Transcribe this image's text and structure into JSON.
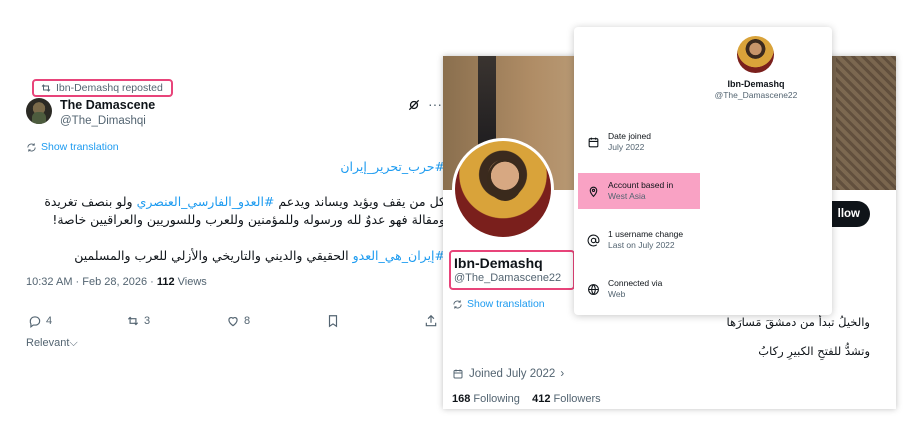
{
  "tweet": {
    "repost_label": "Ibn-Demashq reposted",
    "author_name": "The Damascene",
    "author_handle": "@The_Dimashqi",
    "show_translation": "Show translation",
    "line1": "#حرب_تحرير_إيران",
    "line2_pre": "كل من يقف ويؤيد ويساند ويدعم ",
    "line2_link": "#العدو_الفارسي_العنصري",
    "line2_post": " ولو بنصف تغريدة",
    "line3": "ومقالة فهو عدوٌ لله ورسوله وللمؤمنين وللعرب وللسوريين والعراقيين خاصة!",
    "line4_link": "#إيران_هي_العدو",
    "line4_post": " الحقيقي والديني والتاريخي والأزلي للعرب والمسلمين",
    "time": "10:32 AM · Feb 28, 2026 · ",
    "views_count": "112",
    "views_label": " Views",
    "replies": "4",
    "reposts": "3",
    "likes": "8",
    "relevant": "Relevant"
  },
  "profile": {
    "name": "Ibn-Demashq",
    "handle": "@The_Damascene22",
    "show_translation": "Show translation",
    "follow_label": "llow",
    "bio_line1": "والخيلُ تبدأ من دمشقَ مَسارَها",
    "bio_line2": "وتشدُّ للفتحِ الكبيرِ ركابُ",
    "joined": "Joined July 2022",
    "following_count": "168",
    "following_label": "Following",
    "followers_count": "412",
    "followers_label": "Followers"
  },
  "about_popup": {
    "name": "Ibn-Demashq",
    "handle": "@The_Damascene22",
    "rows": [
      {
        "label": "Date joined",
        "value": "July 2022",
        "icon": "calendar-icon"
      },
      {
        "label": "Account based in",
        "value": "West Asia",
        "icon": "location-pin-icon"
      },
      {
        "label": "1 username change",
        "value": "Last on July 2022",
        "icon": "at-sign-icon"
      },
      {
        "label": "Connected via",
        "value": "Web",
        "icon": "globe-icon"
      }
    ]
  },
  "colors": {
    "highlight_border": "#e8447a",
    "highlight_fill": "#f9a2c4",
    "link": "#1d9bf0",
    "muted": "#536471"
  }
}
